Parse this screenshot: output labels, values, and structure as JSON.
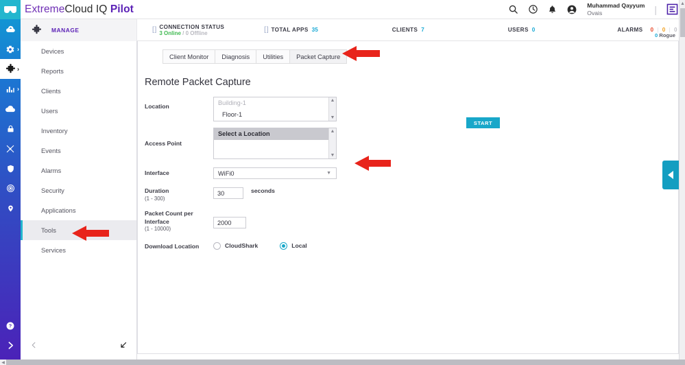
{
  "brand": {
    "logo_icon": "extremecloud-goggles-icon",
    "part1": "Extreme",
    "part2": "Cloud",
    "part3": " IQ ",
    "part4": "Pilot"
  },
  "header": {
    "search_icon": "search-icon",
    "history_icon": "clock-icon",
    "notifications_icon": "bell-icon",
    "account_icon": "user-avatar-icon",
    "user_name_line1": "Muhammad Qayyum",
    "user_name_line2": "Ovais",
    "separator": "|",
    "extreme_logo_icon": "extreme-e-logo-icon"
  },
  "statusbar": {
    "manage_icon": "puzzle-piece-icon",
    "manage_label": "MANAGE",
    "connection": {
      "icon": "bracket-icon",
      "title": "CONNECTION STATUS",
      "online": "3 Online",
      "divider": "/",
      "offline": "0 Offline"
    },
    "total_apps": {
      "icon": "bracket-icon",
      "title": "TOTAL APPS",
      "value": "35"
    },
    "clients": {
      "title": "CLIENTS",
      "value": "7"
    },
    "users": {
      "title": "USERS",
      "value": "0"
    },
    "alarms": {
      "title": "ALARMS",
      "critical": "0",
      "major": "0",
      "minor": "0",
      "pipe": "|"
    },
    "rogue": {
      "value": "0",
      "label": "Rogue"
    }
  },
  "rail": {
    "items": [
      {
        "icon": "cloud-upload-icon",
        "name": "cloud-upload",
        "chevron": ""
      },
      {
        "icon": "gear-icon",
        "name": "configure",
        "chevron": "›"
      },
      {
        "icon": "puzzle-piece-icon",
        "name": "manage",
        "chevron": "›"
      },
      {
        "icon": "bar-chart-icon",
        "name": "analytics",
        "chevron": "›"
      },
      {
        "icon": "cloud-icon",
        "name": "cloud",
        "chevron": ""
      },
      {
        "icon": "lock-icon",
        "name": "security-lock",
        "chevron": ""
      },
      {
        "icon": "network-nodes-icon",
        "name": "network",
        "chevron": ""
      },
      {
        "icon": "shield-icon",
        "name": "shield",
        "chevron": ""
      },
      {
        "icon": "wifi-radar-icon",
        "name": "wireless",
        "chevron": ""
      },
      {
        "icon": "location-pin-icon",
        "name": "location",
        "chevron": ""
      }
    ],
    "bottom": [
      {
        "icon": "help-circle-icon",
        "name": "help"
      },
      {
        "icon": "chevron-right-icon",
        "name": "expand-rail"
      }
    ]
  },
  "menu": {
    "items": [
      {
        "label": "Devices",
        "selected": false
      },
      {
        "label": "Reports",
        "selected": false
      },
      {
        "label": "Clients",
        "selected": false
      },
      {
        "label": "Users",
        "selected": false
      },
      {
        "label": "Inventory",
        "selected": false
      },
      {
        "label": "Events",
        "selected": false
      },
      {
        "label": "Alarms",
        "selected": false
      },
      {
        "label": "Security",
        "selected": false
      },
      {
        "label": "Applications",
        "selected": false
      },
      {
        "label": "Tools",
        "selected": true
      },
      {
        "label": "Services",
        "selected": false
      }
    ],
    "back_icon": "chevron-left-icon",
    "collapse_icon": "collapse-arrow-icon"
  },
  "main": {
    "tabs": [
      {
        "label": "Client Monitor",
        "active": false
      },
      {
        "label": "Diagnosis",
        "active": false
      },
      {
        "label": "Utilities",
        "active": false
      },
      {
        "label": "Packet Capture",
        "active": true
      }
    ],
    "title": "Remote Packet Capture",
    "start_button": "START",
    "form": {
      "location": {
        "label": "Location",
        "options": [
          {
            "text": "Building-1",
            "state": "dim"
          },
          {
            "text": "Floor-1",
            "state": "normal"
          }
        ],
        "scroll_up": "▲",
        "scroll_down": "▼"
      },
      "access_point": {
        "label": "Access Point",
        "options": [
          {
            "text": "Select a Location",
            "state": "selected"
          }
        ],
        "scroll_up": "▲",
        "scroll_down": "▼"
      },
      "interface": {
        "label": "Interface",
        "value": "WiFi0",
        "caret": "▼"
      },
      "duration": {
        "label": "Duration",
        "range": "(1 - 300)",
        "value": "30",
        "unit": "seconds"
      },
      "packet_count": {
        "label": "Packet Count per Interface",
        "range": "(1 - 10000)",
        "value": "2000"
      },
      "download_location": {
        "label": "Download Location",
        "options": [
          {
            "label": "CloudShark",
            "selected": false
          },
          {
            "label": "Local",
            "selected": true
          }
        ]
      }
    }
  },
  "side_handle": {
    "icon": "triangle-left-icon",
    "name": "collapse-side-panel"
  },
  "annotations": {
    "arrow_color": "#e8241b",
    "arrows": [
      {
        "name": "arrow-packet-capture-tab"
      },
      {
        "name": "arrow-interface-field"
      },
      {
        "name": "arrow-tools-menu"
      }
    ]
  },
  "colors": {
    "accent_teal": "#18a7c9",
    "brand_purple": "#5b21b6",
    "online_green": "#3fb950",
    "alarm_red": "#e8472a",
    "alarm_orange": "#f0a022"
  }
}
